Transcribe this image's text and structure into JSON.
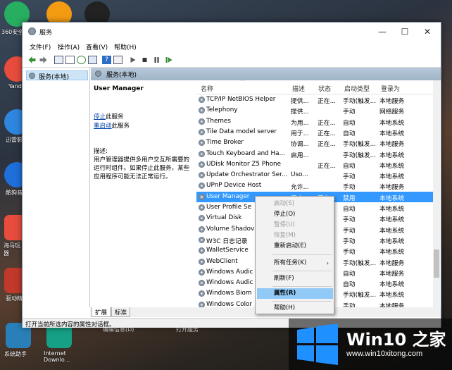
{
  "desktop": {
    "icons": [
      {
        "label": "360安全"
      },
      {
        "label": "Yand"
      },
      {
        "label": "迅雷影"
      },
      {
        "label": "酷狗音"
      },
      {
        "label": "海马玩\n器"
      },
      {
        "label": "驱动精"
      },
      {
        "label": "系统助手"
      },
      {
        "label": "Internet\nDownlo..."
      }
    ],
    "taskbar_fragments": [
      "编辑信息(D)",
      "打开服务"
    ]
  },
  "window": {
    "title": "服务",
    "controls": {
      "minimize": "—",
      "maximize": "☐",
      "close": "✕"
    },
    "menu": [
      "文件(F)",
      "操作(A)",
      "查看(V)",
      "帮助(H)"
    ]
  },
  "tree": {
    "root": "服务(本地)"
  },
  "panel_header": "服务(本地)",
  "details": {
    "service_name": "User Manager",
    "stop_link": "停止",
    "stop_suffix": "此服务",
    "restart_link": "重启动",
    "restart_suffix": "此服务",
    "desc_label": "描述:",
    "desc_lines": [
      "用户管理器提供多用户交互所需要的",
      "运行时组件。如果停止此服务，某些",
      "应用程序可能无法正常运行。"
    ]
  },
  "columns": [
    "名称",
    "描述",
    "状态",
    "启动类型",
    "登录为"
  ],
  "rows": [
    {
      "name": "TCP/IP NetBIOS Helper",
      "desc": "提供...",
      "status": "正在...",
      "startup": "手动(触发...",
      "logon": "本地服务"
    },
    {
      "name": "Telephony",
      "desc": "提供...",
      "status": "",
      "startup": "手动",
      "logon": "网络服务"
    },
    {
      "name": "Themes",
      "desc": "为用...",
      "status": "正在...",
      "startup": "自动",
      "logon": "本地系统"
    },
    {
      "name": "Tile Data model server",
      "desc": "用于...",
      "status": "正在...",
      "startup": "自动",
      "logon": "本地系统"
    },
    {
      "name": "Time Broker",
      "desc": "协调...",
      "status": "正在...",
      "startup": "手动(触发...",
      "logon": "本地服务"
    },
    {
      "name": "Touch Keyboard and Ha...",
      "desc": "启用...",
      "status": "",
      "startup": "手动(触发...",
      "logon": "本地系统"
    },
    {
      "name": "UDisk Monitor Z5 Phone",
      "desc": "",
      "status": "正在...",
      "startup": "自动",
      "logon": "本地系统"
    },
    {
      "name": "Update Orchestrator Ser...",
      "desc": "Uso...",
      "status": "",
      "startup": "手动",
      "logon": "本地系统"
    },
    {
      "name": "UPnP Device Host",
      "desc": "允许...",
      "status": "",
      "startup": "手动",
      "logon": "本地服务"
    },
    {
      "name": "User Manager",
      "desc": "用户...",
      "status": "正在...",
      "startup": "禁用",
      "logon": "本地系统"
    },
    {
      "name": "User Profile Se",
      "desc": "",
      "status": "",
      "startup": "自动",
      "logon": "本地系统"
    },
    {
      "name": "Virtual Disk",
      "desc": "",
      "status": "",
      "startup": "手动",
      "logon": "本地系统"
    },
    {
      "name": "Volume Shadov",
      "desc": "",
      "status": "",
      "startup": "手动",
      "logon": "本地系统"
    },
    {
      "name": "W3C 日志记录",
      "desc": "",
      "status": "",
      "startup": "手动",
      "logon": "本地系统"
    },
    {
      "name": "WalletService",
      "desc": "",
      "status": "",
      "startup": "手动",
      "logon": "本地系统"
    },
    {
      "name": "WebClient",
      "desc": "",
      "status": "",
      "startup": "手动(触发...",
      "logon": "本地服务"
    },
    {
      "name": "Windows Audic",
      "desc": "",
      "status": "",
      "startup": "自动",
      "logon": "本地服务"
    },
    {
      "name": "Windows Audic",
      "desc": "",
      "status": "",
      "startup": "自动",
      "logon": "本地系统"
    },
    {
      "name": "Windows Biom",
      "desc": "",
      "status": "",
      "startup": "手动(触发...",
      "logon": "本地系统"
    },
    {
      "name": "Windows Color",
      "desc": "",
      "status": "",
      "startup": "手动",
      "logon": "本地服务"
    }
  ],
  "tabs": [
    "扩展",
    "标准"
  ],
  "status_text": "打开当前所选内容的属性对话框。",
  "context_menu": {
    "items": [
      {
        "label": "启动(S)",
        "state": "disabled"
      },
      {
        "label": "停止(O)",
        "state": "normal"
      },
      {
        "label": "暂停(U)",
        "state": "disabled"
      },
      {
        "label": "恢复(M)",
        "state": "disabled"
      },
      {
        "label": "重新启动(E)",
        "state": "normal"
      },
      {
        "label": "所有任务(K)",
        "state": "submenu"
      },
      {
        "label": "刷新(F)",
        "state": "normal"
      },
      {
        "label": "属性(R)",
        "state": "highlighted"
      },
      {
        "label": "帮助(H)",
        "state": "normal"
      }
    ],
    "submenu_arrow": "›"
  },
  "watermark": {
    "title": "Win10 之家",
    "url": "www.win10xitong.com"
  },
  "colors": {
    "selection": "#3399ff",
    "menu_highlight": "#91c9f7",
    "link": "#0645ad",
    "win_blue": "#1e90ff"
  }
}
